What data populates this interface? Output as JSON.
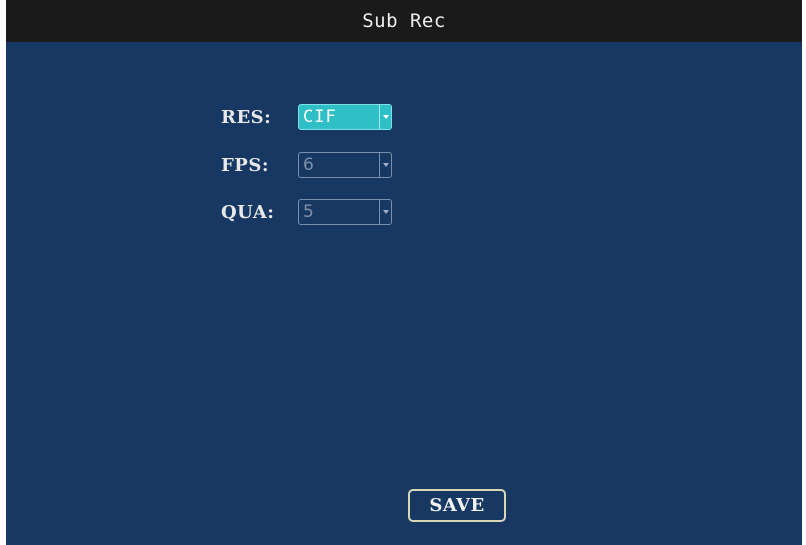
{
  "title": "Sub Rec",
  "fields": [
    {
      "label": "RES:",
      "value": "CIF",
      "active": true
    },
    {
      "label": "FPS:",
      "value": "6",
      "active": false
    },
    {
      "label": "QUA:",
      "value": "5",
      "active": false
    }
  ],
  "save_label": "SAVE",
  "colors": {
    "background": "#173863",
    "titlebar": "#1a1a1a",
    "active_select": "#2ebfc7",
    "text": "#e8e8e8",
    "button_border": "#d8d8b8"
  },
  "icons": {
    "dropdown": "chevron-down-icon"
  }
}
